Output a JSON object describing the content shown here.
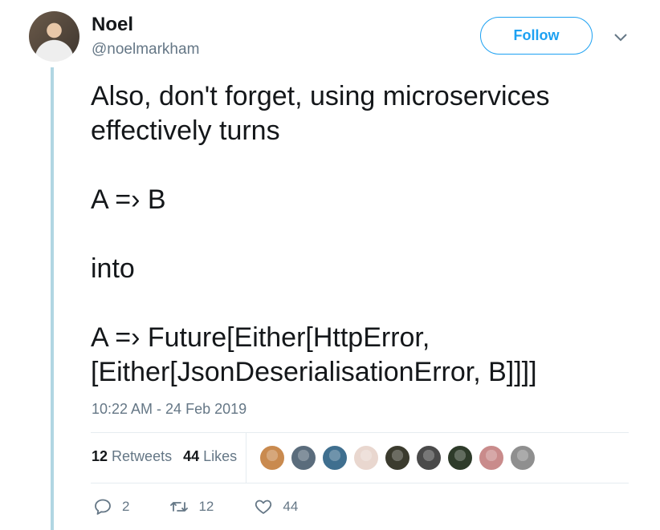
{
  "author": {
    "name": "Noel",
    "handle": "@noelmarkham"
  },
  "follow_label": "Follow",
  "tweet": {
    "lines": [
      "Also, don't forget, using microservices effectively turns",
      "A =› B",
      "into",
      "A =› Future[Either[HttpError, [Either[JsonDeserialisationError, B]]]]"
    ]
  },
  "timestamp": "10:22 AM - 24 Feb 2019",
  "stats": {
    "retweets_count": "12",
    "retweets_label": "Retweets",
    "likes_count": "44",
    "likes_label": "Likes"
  },
  "liker_avatars": [
    {
      "color": "#c98a4f"
    },
    {
      "color": "#5a6c7c"
    },
    {
      "color": "#3f6f8f"
    },
    {
      "color": "#e9d7cf"
    },
    {
      "color": "#3b3b2e"
    },
    {
      "color": "#4a4a4a"
    },
    {
      "color": "#2e3b2a"
    },
    {
      "color": "#c98b8b"
    },
    {
      "color": "#8f8f8f"
    }
  ],
  "actions": {
    "reply_count": "2",
    "retweet_count": "12",
    "like_count": "44"
  },
  "colors": {
    "accent": "#1da1f2",
    "thread_line": "#b1d6e3",
    "muted": "#657786"
  }
}
